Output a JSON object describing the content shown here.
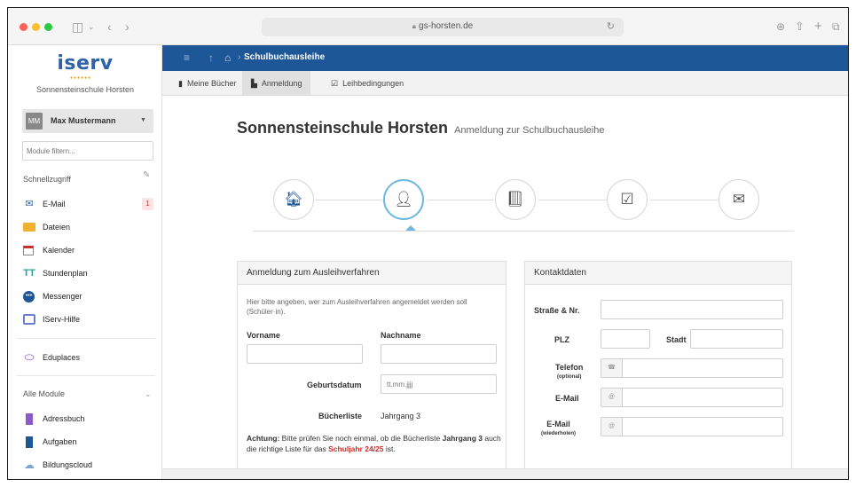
{
  "browser": {
    "url": "gs-horsten.de",
    "colors": {
      "close": "#fe5f57",
      "minimize": "#febc2e",
      "maximize": "#28c840"
    },
    "icons": [
      "sidebar-toggle-icon",
      "chevron-down-icon",
      "back-icon",
      "forward-icon",
      "shield-icon",
      "lock-icon",
      "reload-icon",
      "download-icon",
      "share-icon",
      "new-tab-icon",
      "tabs-overview-icon"
    ]
  },
  "sidebar": {
    "logo": "iserv",
    "school": "Sonnensteinschule Horsten",
    "user": {
      "initials": "MM",
      "name": "Max Mustermann"
    },
    "module_filter_placeholder": "Module filtern...",
    "quick_access_label": "Schnellzugriff",
    "quick_items": [
      {
        "label": "E-Mail",
        "badge": "1",
        "icon": "mail-icon"
      },
      {
        "label": "Dateien",
        "icon": "folder-icon"
      },
      {
        "label": "Kalender",
        "icon": "calendar-icon"
      },
      {
        "label": "Stundenplan",
        "icon": "timetable-icon"
      },
      {
        "label": "Messenger",
        "icon": "chat-icon"
      },
      {
        "label": "IServ-Hilfe",
        "icon": "help-icon"
      }
    ],
    "extra_items": [
      {
        "label": "Eduplaces",
        "icon": "eduplaces-icon"
      }
    ],
    "all_modules_label": "Alle Module",
    "module_items": [
      {
        "label": "Adressbuch",
        "icon": "addressbook-icon"
      },
      {
        "label": "Aufgaben",
        "icon": "tasks-icon"
      },
      {
        "label": "Bildungscloud",
        "icon": "cloud-icon"
      }
    ]
  },
  "topnav": {
    "breadcrumb": "Schulbuchausleihe",
    "accent": "#1e5797"
  },
  "tabs": [
    {
      "label": "Meine Bücher",
      "icon": "book-icon",
      "active": false
    },
    {
      "label": "Anmeldung",
      "icon": "file-icon",
      "active": true
    },
    {
      "label": "Leihbedingungen",
      "icon": "check-square-icon",
      "active": false
    }
  ],
  "page": {
    "title": "Sonnensteinschule Horsten",
    "subtitle": "Anmeldung zur Schulbuchausleihe"
  },
  "steps": [
    {
      "icon": "home-icon",
      "glyph": "🏠︎",
      "active": false
    },
    {
      "icon": "user-icon",
      "glyph": "👤︎",
      "active": true
    },
    {
      "icon": "book-icon",
      "glyph": "📕︎",
      "active": false
    },
    {
      "icon": "check-square-icon",
      "glyph": "☑",
      "active": false
    },
    {
      "icon": "envelope-icon",
      "glyph": "✉",
      "active": false
    }
  ],
  "registration": {
    "heading": "Anmeldung zum Ausleihverfahren",
    "help": "Hier bitte angeben, wer zum Ausleihverfahren angemeldet werden soll (Schüler·in).",
    "first_name_label": "Vorname",
    "first_name_value": "",
    "last_name_label": "Nachname",
    "last_name_value": "",
    "birthdate_label": "Geburtsdatum",
    "birthdate_placeholder": "tt.mm.jjjj",
    "booklist_label": "Bücherliste",
    "booklist_value": "Jahrgang 3",
    "warning_bold": "Achtung:",
    "warning_text1": " Bitte prüfen Sie noch einmal, ob die Bücherliste ",
    "warning_year_bold": "Jahrgang 3",
    "warning_text2": " auch die richtige Liste für das ",
    "warning_school_year": "Schuljahr 24/25",
    "warning_text3": " ist.",
    "warning_color": "#c9302c"
  },
  "contact": {
    "heading": "Kontaktdaten",
    "street_label": "Straße & Nr.",
    "zip_label": "PLZ",
    "city_label": "Stadt",
    "phone_label": "Telefon",
    "phone_sub": "(optional)",
    "email_label": "E-Mail",
    "email_repeat_label": "E-Mail",
    "email_repeat_sub": "(wiederholen)",
    "street_value": "",
    "zip_value": "",
    "city_value": "",
    "phone_value": "",
    "email_value": "",
    "email_repeat_value": ""
  }
}
